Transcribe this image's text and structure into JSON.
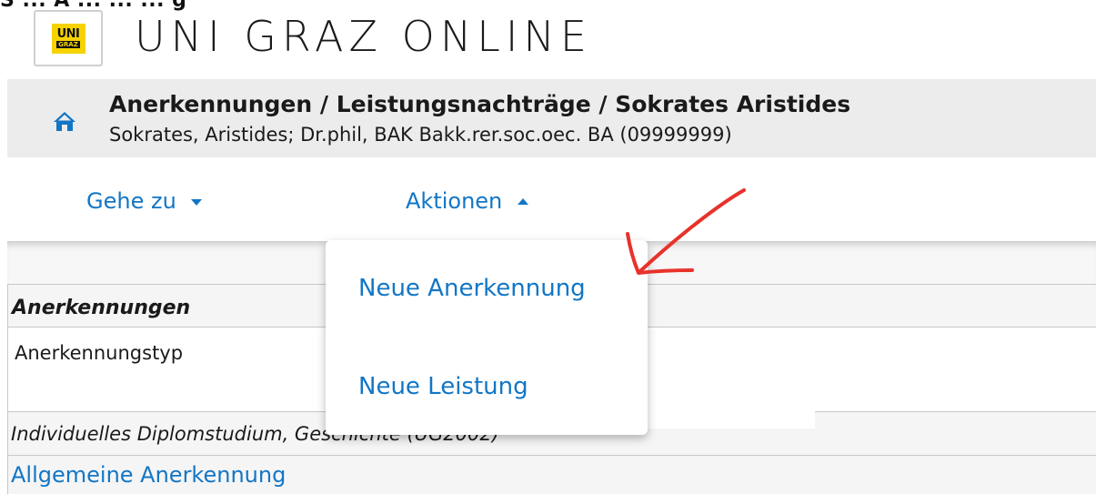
{
  "top_cut_text": "S    ...    A    ...    ...    ...    g",
  "logo": {
    "line1": "UNI",
    "line2": "GRAZ"
  },
  "app": {
    "title": "UNI GRAZ ONLINE"
  },
  "header": {
    "title": "Anerkennungen / Leistungsnachträge  / Sokrates Aristides",
    "subtitle": "Sokrates, Aristides; Dr.phil, BAK Bakk.rer.soc.oec. BA (09999999)"
  },
  "nav": {
    "goto_label": "Gehe zu",
    "actions_label": "Aktionen"
  },
  "dropdown": {
    "items": [
      {
        "label": "Neue Anerkennung"
      },
      {
        "label": "Neue Leistung"
      }
    ]
  },
  "table": {
    "section_title": "Anerkennungen",
    "column_header": "Anerkennungstyp",
    "study_row": "Individuelles Diplomstudium, Geschichte (UG2002)",
    "type_link": "Allgemeine Anerkennung"
  },
  "colors": {
    "link": "#1276c5",
    "annotation": "#e8322b",
    "logo_yellow": "#f6d300"
  },
  "icons": [
    "home-icon",
    "caret-down-icon",
    "caret-up-icon",
    "annotation-arrow"
  ]
}
